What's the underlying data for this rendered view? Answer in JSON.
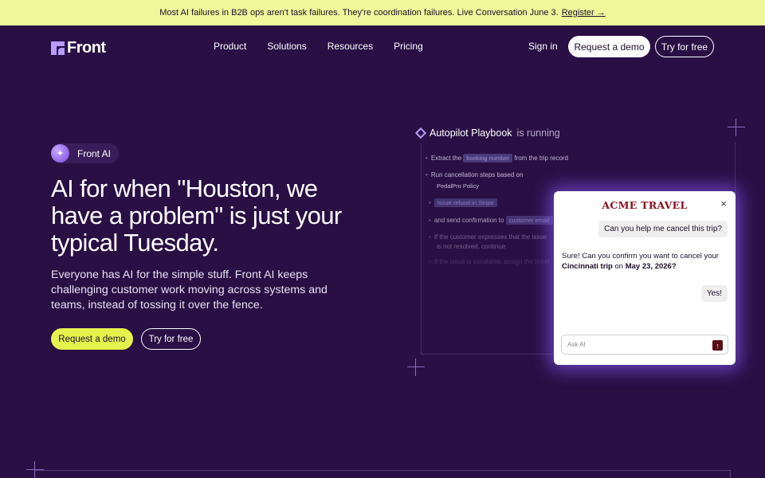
{
  "announcement": {
    "text": "Most AI failures in B2B ops aren't task failures. They're coordination failures. Live Conversation June 3.",
    "link": "Register →"
  },
  "nav": {
    "logo": "Front",
    "menu": [
      "Product",
      "Solutions",
      "Resources",
      "Pricing"
    ],
    "sign_in": "Sign in",
    "request_demo": "Request a demo",
    "try_free": "Try for free"
  },
  "hero": {
    "badge": "Front AI",
    "headline": "AI for when \"Houston, we have a problem\" is just your typical Tuesday.",
    "subheadline": "Everyone has AI for the simple stuff. Front AI keeps challenging customer work moving across systems and teams, instead of tossing it over the fence.",
    "cta_demo": "Request a demo",
    "cta_try": "Try for free"
  },
  "playbook": {
    "title_bold": "Autopilot Playbook",
    "title_rest": "is running",
    "steps": [
      {
        "pre": "Extract the",
        "chip": "booking number",
        "post": "from the trip record"
      },
      {
        "pre": "Run cancellation steps based on",
        "chip": "PedalPro Policy",
        "post": ""
      },
      {
        "pre": "",
        "chip": "Issue refund in Stripe",
        "post": ""
      },
      {
        "pre": "and send confirmation to",
        "chip": "customer email",
        "post": ""
      },
      {
        "pre": "If the customer expresses that the issue",
        "chip": "",
        "post": "is not resolved, continue"
      },
      {
        "pre": "If the issue is escalated, assign the ticket",
        "chip": "",
        "post": ""
      }
    ]
  },
  "chat": {
    "brand": "ACME TRAVEL",
    "close": "×",
    "user_msg_1": "Can you help me cancel this trip?",
    "bot_msg_pre": "Sure! Can you confirm you want to cancel your",
    "bot_msg_trip": "Cincinnati trip",
    "bot_msg_on": "on",
    "bot_msg_date": "May 23, 2026?",
    "user_msg_2": "Yes!",
    "input_placeholder": "Ask AI",
    "send_icon": "↑"
  }
}
